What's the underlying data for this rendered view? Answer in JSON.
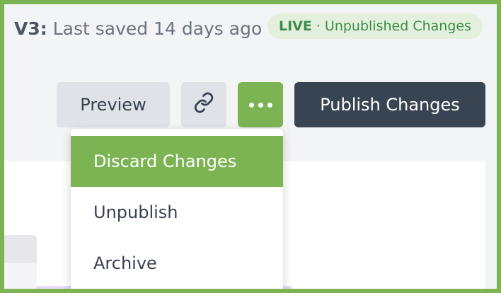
{
  "header": {
    "version": "V3:",
    "saved_text": "Last saved 14 days ago",
    "status": {
      "live": "LIVE",
      "separator": "·",
      "text": "Unpublished Changes",
      "color": "#3f8b4b",
      "background": "#e3f1dc"
    }
  },
  "toolbar": {
    "preview_label": "Preview",
    "link_icon": "link-icon",
    "more_icon": "more-horizontal-icon",
    "publish_label": "Publish Changes"
  },
  "menu": {
    "items": [
      {
        "label": "Discard Changes",
        "active": true
      },
      {
        "label": "Unpublish"
      },
      {
        "label": "Archive"
      }
    ]
  },
  "colors": {
    "accent": "#7cb453",
    "publish_button": "#394452",
    "secondary_button": "#dfe3e8"
  }
}
